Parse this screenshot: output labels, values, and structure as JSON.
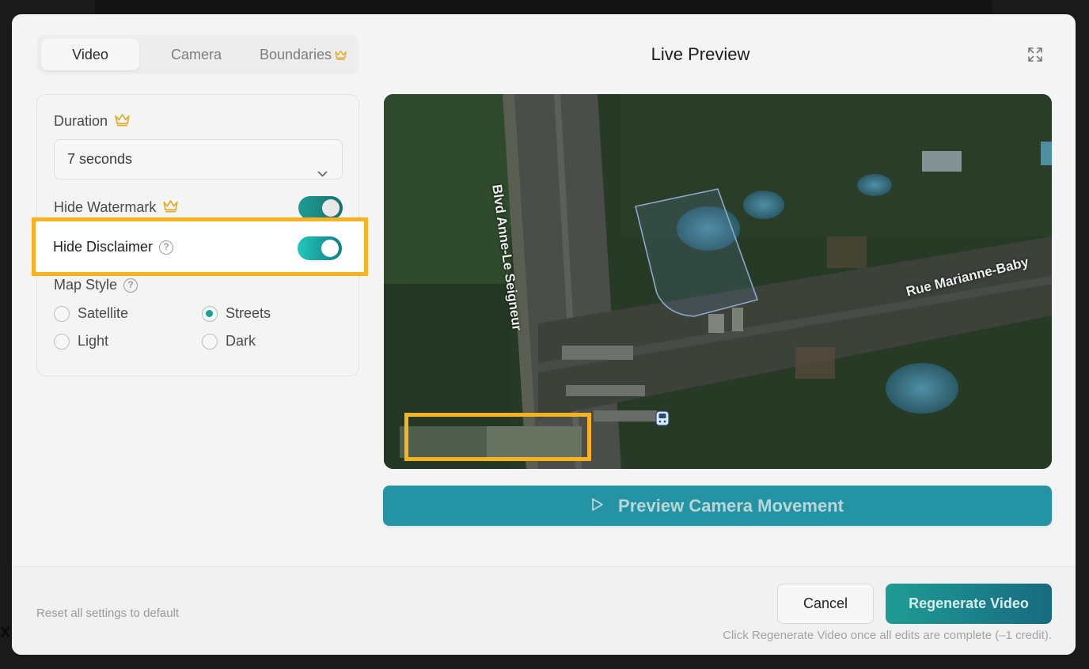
{
  "background": {
    "partial_text": "xp"
  },
  "tabs": [
    {
      "label": "Video",
      "active": true
    },
    {
      "label": "Camera",
      "active": false
    },
    {
      "label": "Boundaries",
      "premium": true,
      "active": false
    }
  ],
  "settings": {
    "duration": {
      "label": "Duration",
      "value": "7 seconds",
      "premium": true
    },
    "hide_watermark": {
      "label": "Hide Watermark",
      "enabled": true,
      "premium": true
    },
    "hide_disclaimer": {
      "label": "Hide Disclaimer",
      "enabled": true
    },
    "map_style": {
      "label": "Map Style",
      "options": [
        {
          "label": "Satellite",
          "selected": false
        },
        {
          "label": "Streets",
          "selected": true
        },
        {
          "label": "Light",
          "selected": false
        },
        {
          "label": "Dark",
          "selected": false
        }
      ]
    }
  },
  "preview": {
    "title": "Live Preview",
    "street_labels": [
      "Blvd Anne-Le Seigneur",
      "Rue Marianne-Baby"
    ],
    "button_label": "Preview Camera Movement"
  },
  "footer": {
    "reset_label": "Reset all settings to default",
    "cancel_label": "Cancel",
    "regenerate_label": "Regenerate Video",
    "note": "Click Regenerate Video once all edits are complete (–1 credit)."
  },
  "colors": {
    "accent": "#1a9e96",
    "highlight": "#fab21e",
    "crown": "#e0b030"
  },
  "icons": [
    "crown-icon",
    "chevron-down-icon",
    "help-icon",
    "expand-icon",
    "play-icon",
    "bus-stop-icon"
  ]
}
